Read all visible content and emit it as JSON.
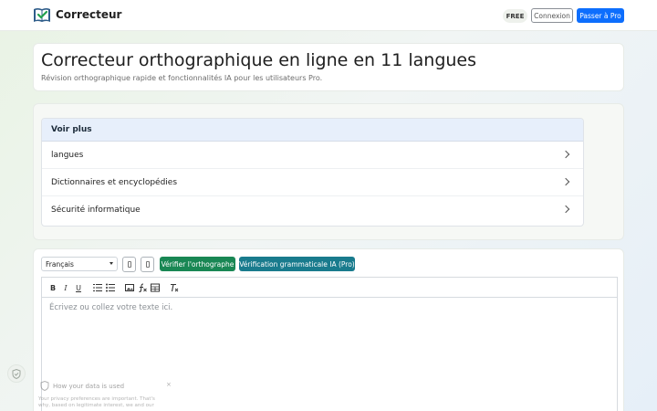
{
  "header": {
    "brand": "Correcteur",
    "badge": "FREE",
    "login_label": "Connexion",
    "upgrade_label": "Passer à Pro"
  },
  "hero": {
    "title": "Correcteur orthographique en ligne en 11 langues",
    "subtitle": "Révision orthographique rapide et fonctionnalités IA pour les utilisateurs Pro."
  },
  "more": {
    "heading": "Voir plus",
    "items": [
      {
        "label": "langues"
      },
      {
        "label": "Dictionnaires et encyclopédies"
      },
      {
        "label": "Sécurité informatique"
      }
    ]
  },
  "editor": {
    "language": "Français",
    "check_label": "Vérifier l'orthographe",
    "grammar_label": "Vérification grammaticale IA (Pro)",
    "toolbar": {
      "bold": "B",
      "italic": "I",
      "underline": "U"
    },
    "placeholder": "Écrivez ou collez votre texte ici."
  },
  "privacy": {
    "title": "How your data is used",
    "close": "×",
    "text": "Your privacy preferences are important. That's why, based on legitimate interest, we and our"
  },
  "colors": {
    "primary": "#0d6efd",
    "success": "#198754",
    "info": "#197b8d",
    "accordion_header": "#e7effb"
  }
}
